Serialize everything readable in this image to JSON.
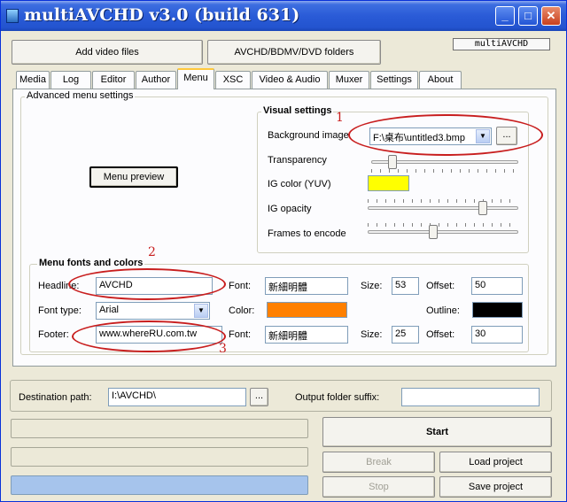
{
  "window": {
    "title": "multiAVCHD v3.0 (build 631)",
    "controls": {
      "minimize": "_",
      "maximize": "□",
      "close": "✕"
    }
  },
  "top_buttons": {
    "add_video": "Add video files",
    "folders": "AVCHD/BDMV/DVD folders",
    "logo": "multiAVCHD"
  },
  "tabs": [
    "Media",
    "Log",
    "Editor",
    "Author",
    "Menu",
    "XSC",
    "Video & Audio",
    "Muxer",
    "Settings",
    "About"
  ],
  "active_tab": "Menu",
  "advanced": {
    "label": "Advanced menu settings",
    "menu_preview": "Menu preview"
  },
  "visual": {
    "label": "Visual settings",
    "background_label": "Background image",
    "background_value": "F:\\桌布\\untitled3.bmp",
    "browse": "...",
    "transparency_label": "Transparency",
    "transparency_level": 0.12,
    "ig_color_label": "IG color (YUV)",
    "ig_color": "#ffff00",
    "ig_opacity_label": "IG opacity",
    "ig_opacity_level": 0.78,
    "frames_label": "Frames to encode",
    "frames_level": 0.43
  },
  "fonts": {
    "label": "Menu fonts and colors",
    "headline_label": "Headline:",
    "headline_value": "AVCHD",
    "font_label": "Font:",
    "headline_font": "新細明體",
    "size_label": "Size:",
    "headline_size": "53",
    "offset_label": "Offset:",
    "headline_offset": "50",
    "font_type_label": "Font type:",
    "font_type_value": "Arial",
    "color_label": "Color:",
    "text_color": "#ff8000",
    "outline_label": "Outline:",
    "outline_color": "#000000",
    "footer_label": "Footer:",
    "footer_value": "www.whereRU.com.tw",
    "footer_font": "新細明體",
    "footer_size": "25",
    "footer_offset": "30"
  },
  "bottom": {
    "destination_label": "Destination path:",
    "destination_value": "I:\\AVCHD\\",
    "browse": "...",
    "suffix_label": "Output folder suffix:",
    "suffix_value": "",
    "start": "Start",
    "break": "Break",
    "load_project": "Load project",
    "stop": "Stop",
    "save_project": "Save project"
  },
  "annotations": [
    "1",
    "2",
    "3"
  ]
}
